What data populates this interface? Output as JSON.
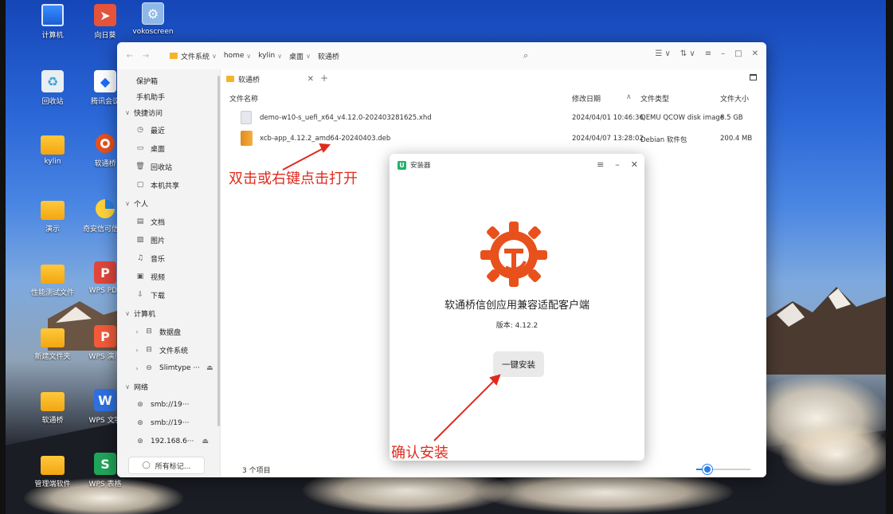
{
  "desktop": {
    "icons": [
      {
        "label": "计算机",
        "icon": "computer-icon"
      },
      {
        "label": "向日葵",
        "icon": "sunflower-remote-icon"
      },
      {
        "label": "vokoscreen",
        "icon": "vokoscreen-icon"
      },
      {
        "label": "回收站",
        "icon": "trash-icon"
      },
      {
        "label": "腾讯会议",
        "icon": "tencent-meeting-icon"
      },
      {
        "label": "kylin",
        "icon": "folder-icon"
      },
      {
        "label": "软通桥",
        "icon": "ruantongqiao-icon"
      },
      {
        "label": "演示",
        "icon": "folder-icon"
      },
      {
        "label": "奇安信可信浏览器",
        "icon": "browser-icon"
      },
      {
        "label": "性能测试文件",
        "icon": "folder-icon"
      },
      {
        "label": "WPS PDF",
        "icon": "wps-pdf-icon"
      },
      {
        "label": "新建文件夹",
        "icon": "folder-icon"
      },
      {
        "label": "WPS 演示",
        "icon": "wps-presentation-icon"
      },
      {
        "label": "软通桥",
        "icon": "folder-icon"
      },
      {
        "label": "WPS 文字",
        "icon": "wps-writer-icon"
      },
      {
        "label": "管理端软件",
        "icon": "folder-icon"
      },
      {
        "label": "WPS 表格",
        "icon": "wps-spreadsheet-icon"
      }
    ]
  },
  "file_manager": {
    "breadcrumb": [
      "文件系统",
      "home",
      "kylin",
      "桌面",
      "软通桥"
    ],
    "sidebar": {
      "items": [
        {
          "label": "保护箱",
          "icon": ""
        },
        {
          "label": "手机助手",
          "icon": ""
        },
        {
          "label": "快捷访问",
          "icon": "",
          "section": true
        },
        {
          "label": "最近",
          "icon": "clock-icon"
        },
        {
          "label": "桌面",
          "icon": "desktop-icon"
        },
        {
          "label": "回收站",
          "icon": "trash-icon"
        },
        {
          "label": "本机共享",
          "icon": "share-icon"
        },
        {
          "label": "个人",
          "icon": "",
          "section": true
        },
        {
          "label": "文档",
          "icon": "document-icon"
        },
        {
          "label": "图片",
          "icon": "image-icon"
        },
        {
          "label": "音乐",
          "icon": "music-icon"
        },
        {
          "label": "视频",
          "icon": "video-icon"
        },
        {
          "label": "下载",
          "icon": "download-icon"
        },
        {
          "label": "计算机",
          "icon": "",
          "section": true
        },
        {
          "label": "数据盘",
          "icon": "drive-icon",
          "expandable": true
        },
        {
          "label": "文件系统",
          "icon": "drive-icon",
          "expandable": true
        },
        {
          "label": "Slimtype ···",
          "icon": "disc-icon",
          "expandable": true,
          "eject": true
        },
        {
          "label": "网络",
          "icon": "",
          "section": true
        },
        {
          "label": "smb://19···",
          "icon": "network-icon"
        },
        {
          "label": "smb://19···",
          "icon": "network-icon"
        },
        {
          "label": "192.168.6···",
          "icon": "network-icon",
          "eject": true
        }
      ],
      "all_tags_label": "所有标记..."
    },
    "tab": {
      "label": "软通桥"
    },
    "columns": [
      "文件名称",
      "修改日期",
      "文件类型",
      "文件大小"
    ],
    "files": [
      {
        "name": "demo-w10-s_uefi_x64_v4.12.0-202403281625.xhd",
        "modified": "2024/04/01 10:46:36",
        "type": "QEMU QCOW disk image",
        "size": "8.5 GB",
        "icon": "disk-image-icon"
      },
      {
        "name": "xcb-app_4.12.2_amd64-20240403.deb",
        "modified": "2024/04/07 13:28:02",
        "type": "Debian 软件包",
        "size": "200.4 MB",
        "icon": "deb-package-icon"
      }
    ],
    "status_text": "3 个项目",
    "zoom_level": 0.2
  },
  "installer": {
    "title": "安装器",
    "app_name": "软通桥信创应用兼容适配客户端",
    "version": "版本: 4.12.2",
    "install_button": "一键安装",
    "logo_color": "#e8501c"
  },
  "annotations": {
    "open_hint": "双击或右键点击打开",
    "confirm_hint": "确认安装",
    "color": "#e12a1e"
  }
}
